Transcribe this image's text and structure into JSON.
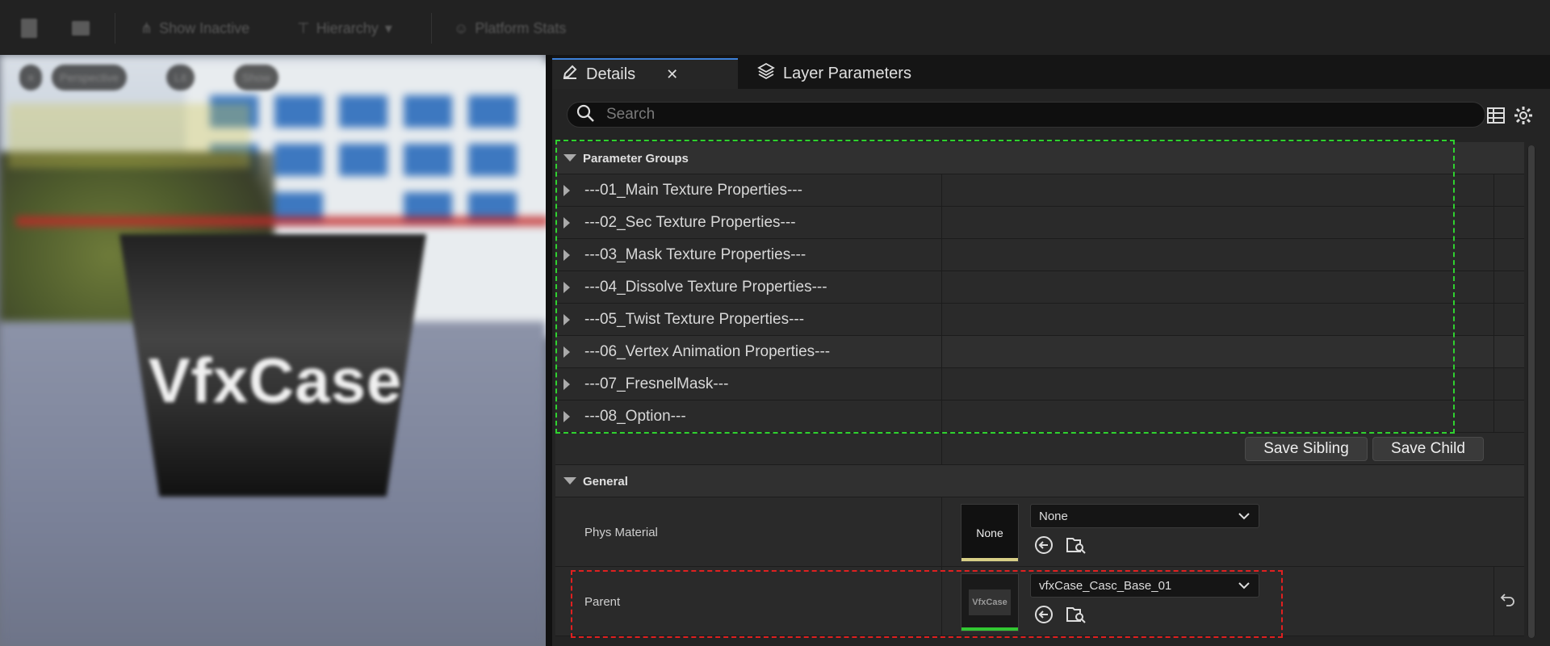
{
  "toolbar": {
    "show_inactive": "Show Inactive",
    "hierarchy": "Hierarchy",
    "platform_stats": "Platform Stats"
  },
  "viewport": {
    "perspective": "Perspective",
    "lit": "Lit",
    "show": "Show",
    "logo_text": "VfxCase"
  },
  "tabs": [
    {
      "label": "Details",
      "icon": "pencil-icon",
      "active": true
    },
    {
      "label": "Layer Parameters",
      "icon": "layers-icon",
      "active": false
    }
  ],
  "search": {
    "placeholder": "Search",
    "value": ""
  },
  "parameter_groups": {
    "label": "Parameter Groups",
    "items": [
      "---01_Main Texture Properties---",
      "---02_Sec Texture Properties---",
      "---03_Mask Texture Properties---",
      "---04_Dissolve Texture  Properties---",
      "---05_Twist Texture Properties---",
      "---06_Vertex Animation Properties---",
      "---07_FresnelMask---",
      "---08_Option---"
    ]
  },
  "save": {
    "sibling": "Save Sibling",
    "child": "Save Child"
  },
  "general": {
    "label": "General",
    "phys_material": {
      "label": "Phys Material",
      "thumb": "None",
      "value": "None",
      "thumb_bar_color": "#d8cf86"
    },
    "parent": {
      "label": "Parent",
      "thumb": "VfxCase",
      "value": "vfxCase_Casc_Base_01",
      "thumb_bar_color": "#32c832"
    }
  },
  "colors": {
    "tab_accent": "#3c80d8",
    "highlight_green": "#2fd22f",
    "highlight_red": "#e02020"
  }
}
